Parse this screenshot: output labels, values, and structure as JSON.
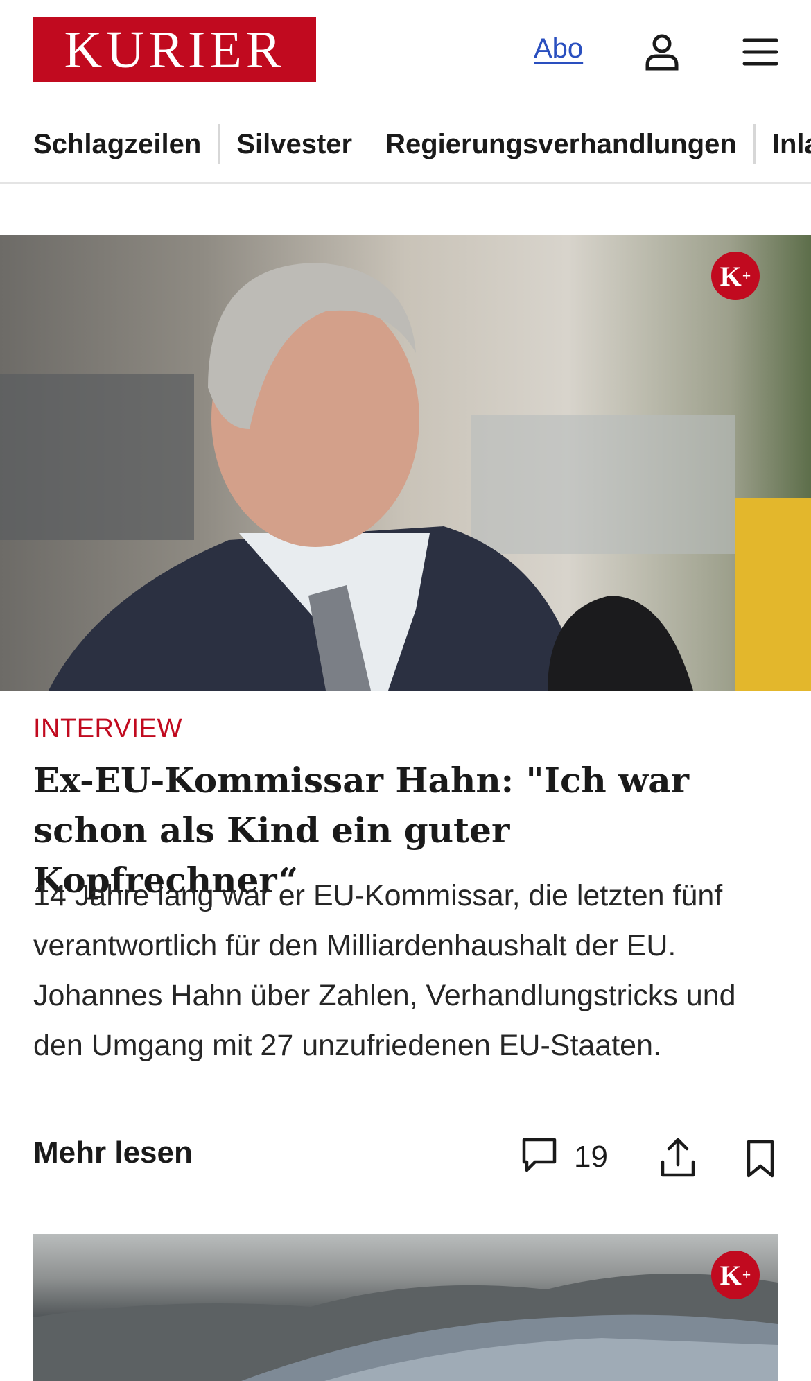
{
  "header": {
    "logo": "KURIER",
    "abo_label": "Abo",
    "user_icon": "user-icon",
    "menu_icon": "menu-icon"
  },
  "nav": {
    "items": [
      "Schlagzeilen",
      "Silvester",
      "Regierungsverhandlungen",
      "Inla"
    ]
  },
  "article": {
    "badge": "K+",
    "kicker": "INTERVIEW",
    "headline": "Ex-EU-Kommissar Hahn: \"Ich war schon als Kind ein guter Kopfrechner“",
    "teaser": "14 Jahre lang war er EU-Kommissar, die letzten fünf verantwortlich für den Milliardenhaushalt der EU. Johannes Hahn über Zahlen, Verhandlungstricks und den Umgang mit 27 unzufriedenen EU-Staaten.",
    "more_label": "Mehr lesen",
    "comment_count": "19",
    "icons": [
      "comment-icon",
      "share-icon",
      "bookmark-icon"
    ]
  },
  "second_article": {
    "badge": "K+"
  },
  "colors": {
    "brand": "#c10a1f",
    "link": "#2a4fbf"
  }
}
